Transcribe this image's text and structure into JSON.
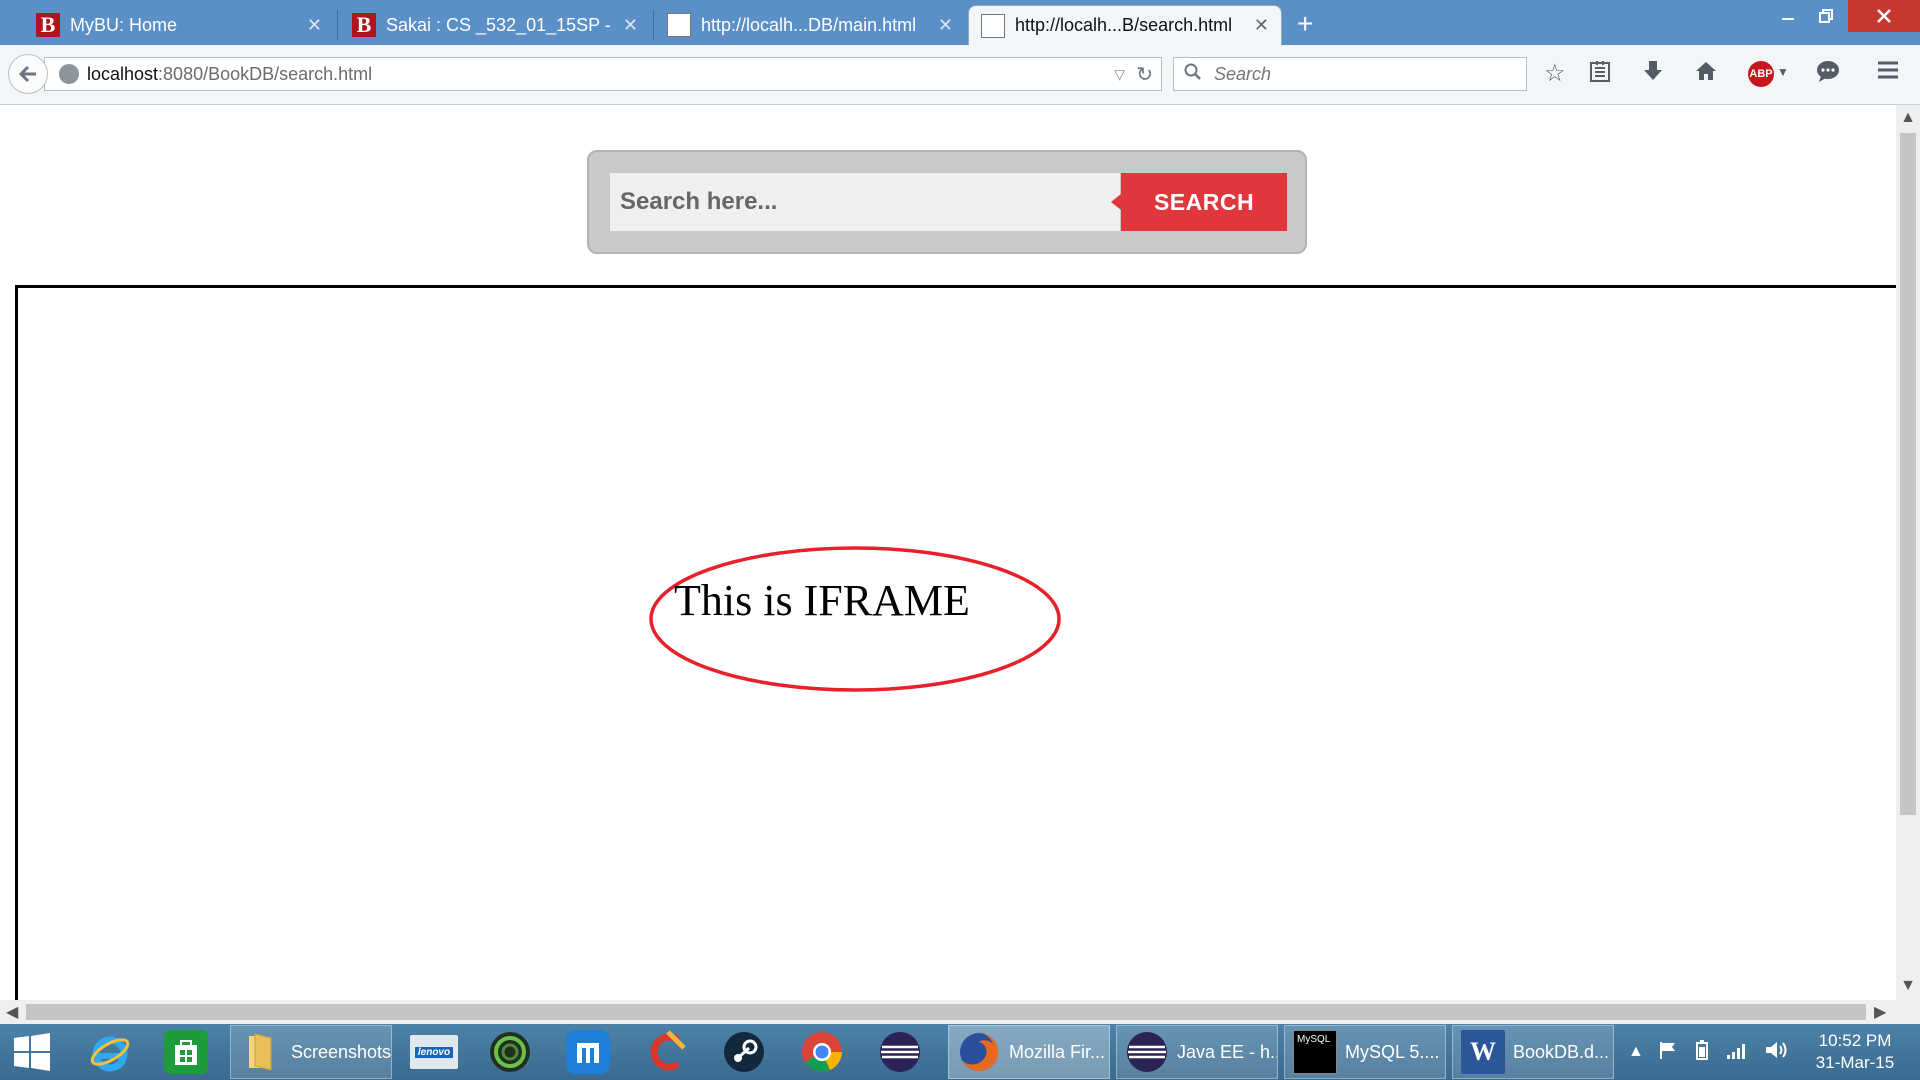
{
  "browser": {
    "tabs": [
      {
        "title": "MyBU: Home",
        "icon": "b-icon"
      },
      {
        "title": "Sakai : CS _532_01_15SP - ...",
        "icon": "b-icon"
      },
      {
        "title": "http://localh...DB/main.html",
        "icon": "page-icon"
      },
      {
        "title": "http://localh...B/search.html",
        "icon": "page-icon",
        "active": true
      }
    ],
    "new_tab_symbol": "+",
    "url_host": "localhost",
    "url_rest": ":8080/BookDB/search.html",
    "search_placeholder": "Search",
    "adblock_label": "ABP"
  },
  "page": {
    "search_placeholder": "Search here...",
    "search_button": "SEARCH",
    "iframe_text": "This is IFRAME",
    "annotation_color": "#e8202a"
  },
  "taskbar": {
    "items": [
      {
        "name": "start",
        "icon": "windows-icon"
      },
      {
        "name": "internet-explorer",
        "icon": "ie-icon"
      },
      {
        "name": "store",
        "icon": "store-icon"
      },
      {
        "name": "file-explorer",
        "icon": "folder-icon",
        "label": "Screenshots"
      },
      {
        "name": "lenovo",
        "icon": "lenovo-icon"
      },
      {
        "name": "green-app",
        "icon": "circle-app-icon"
      },
      {
        "name": "maxthon",
        "icon": "maxthon-icon"
      },
      {
        "name": "ccleaner",
        "icon": "ccleaner-icon"
      },
      {
        "name": "steam",
        "icon": "steam-icon"
      },
      {
        "name": "chrome",
        "icon": "chrome-icon"
      },
      {
        "name": "eclipse",
        "icon": "eclipse-icon"
      },
      {
        "name": "firefox",
        "icon": "firefox-icon",
        "label": "Mozilla Fir..."
      },
      {
        "name": "eclipse-javaee",
        "icon": "eclipse-icon",
        "label": "Java EE - h..."
      },
      {
        "name": "mysql",
        "icon": "mysql-icon",
        "label": "MySQL 5...."
      },
      {
        "name": "word",
        "icon": "word-icon",
        "label": "BookDB.d..."
      }
    ],
    "clock_time": "10:52 PM",
    "clock_date": "31-Mar-15",
    "mysql_icon_text": "MySQL",
    "word_icon_text": "W",
    "lenovo_icon_text": "lenovo"
  }
}
